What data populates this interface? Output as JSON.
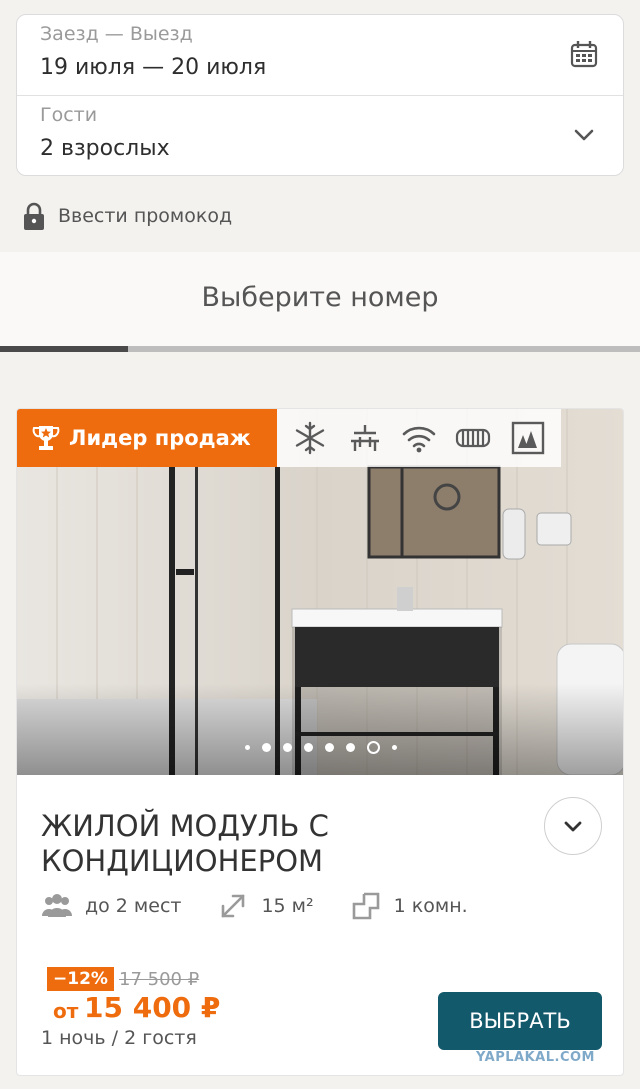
{
  "booking": {
    "dates_label": "Заезд — Выезд",
    "dates_value": "19 июля — 20 июля",
    "guests_label": "Гости",
    "guests_value": "2 взрослых",
    "promo_label": "Ввести промокод"
  },
  "heading": "Выберите номер",
  "rooms_progress": 0.2,
  "room": {
    "badge": "Лидер продаж",
    "amenities": [
      "snowflake-icon",
      "shower-icon",
      "wifi-icon",
      "heater-icon",
      "picture-icon"
    ],
    "gallery": {
      "count": 8,
      "active_index": 6
    },
    "title": "ЖИЛОЙ МОДУЛЬ С КОНДИЦИОНЕРОМ",
    "features": {
      "capacity": "до 2 мест",
      "area": "15 м²",
      "rooms": "1 комн."
    },
    "discount": "−12%",
    "old_price": "17 500 ₽",
    "price_prefix": "от",
    "price": "15 400 ₽",
    "price_note": "1 ночь / 2 гостя",
    "select_label": "ВЫБРАТЬ"
  },
  "watermark": "YAPLAKAL.COM",
  "colors": {
    "accent": "#ef6c0e",
    "button": "#12596b",
    "background": "#f3f2ef"
  }
}
